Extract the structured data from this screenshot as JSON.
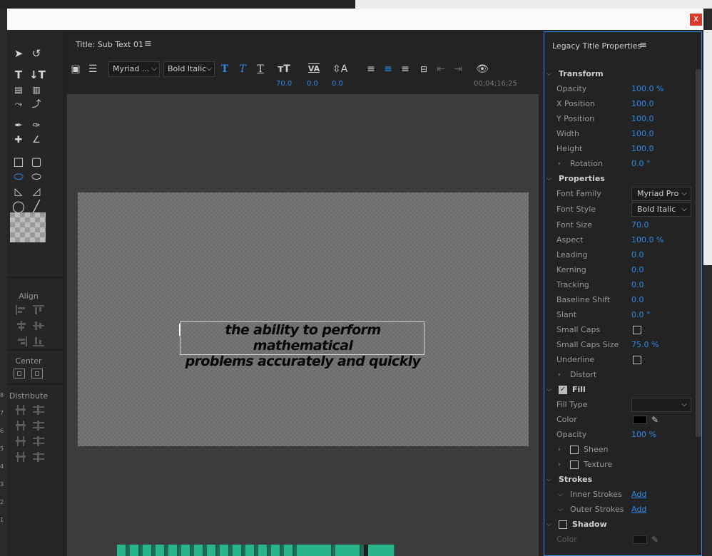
{
  "window": {
    "close_label": "x"
  },
  "tools": {
    "align_label": "Align",
    "center_label": "Center",
    "distribute_label": "Distribute"
  },
  "panel": {
    "title": "Title: Sub Text 01",
    "menu_icon": "hamburger-menu-icon",
    "font_family": "Myriad ...",
    "font_style": "Bold Italic",
    "font_size_value": "70.0",
    "kerning_value": "0.0",
    "leading_value": "0.0",
    "timecode": "00;04;16;25",
    "title_text_line1": "the ability to perform mathematical",
    "title_text_line2": "problems accurately and quickly"
  },
  "props": {
    "title": "Legacy Title Properties",
    "sections": {
      "transform": "Transform",
      "properties": "Properties",
      "fill": "Fill",
      "strokes": "Strokes",
      "shadow": "Shadow"
    },
    "opacity": {
      "label": "Opacity",
      "value": "100.0 %"
    },
    "x_position": {
      "label": "X Position",
      "value": "100.0"
    },
    "y_position": {
      "label": "Y Position",
      "value": "100.0"
    },
    "width": {
      "label": "Width",
      "value": "100.0"
    },
    "height": {
      "label": "Height",
      "value": "100.0"
    },
    "rotation": {
      "label": "Rotation",
      "value": "0.0 °"
    },
    "font_family": {
      "label": "Font Family",
      "value": "Myriad Pro"
    },
    "font_style": {
      "label": "Font Style",
      "value": "Bold Italic"
    },
    "font_size": {
      "label": "Font Size",
      "value": "70.0"
    },
    "aspect": {
      "label": "Aspect",
      "value": "100.0 %"
    },
    "leading": {
      "label": "Leading",
      "value": "0.0"
    },
    "kerning": {
      "label": "Kerning",
      "value": "0.0"
    },
    "tracking": {
      "label": "Tracking",
      "value": "0.0"
    },
    "baseline_shift": {
      "label": "Baseline Shift",
      "value": "0.0"
    },
    "slant": {
      "label": "Slant",
      "value": "0.0 °"
    },
    "small_caps": {
      "label": "Small Caps",
      "checked": false
    },
    "small_caps_size": {
      "label": "Small Caps Size",
      "value": "75.0 %"
    },
    "underline": {
      "label": "Underline",
      "checked": false
    },
    "distort": {
      "label": "Distort"
    },
    "fill_checked": true,
    "fill_type": {
      "label": "Fill Type",
      "value": ""
    },
    "fill_color": {
      "label": "Color",
      "value": "#000000"
    },
    "fill_opacity": {
      "label": "Opacity",
      "value": "100 %"
    },
    "sheen": {
      "label": "Sheen",
      "checked": false
    },
    "texture": {
      "label": "Texture",
      "checked": false
    },
    "inner_strokes": {
      "label": "Inner Strokes",
      "action": "Add"
    },
    "outer_strokes": {
      "label": "Outer Strokes",
      "action": "Add"
    },
    "shadow_checked": false,
    "shadow_color": {
      "label": "Color",
      "value": "#000000"
    }
  },
  "colors": {
    "accent": "#2d8ceb",
    "close": "#d83a2c",
    "clip": "#29b48c"
  }
}
